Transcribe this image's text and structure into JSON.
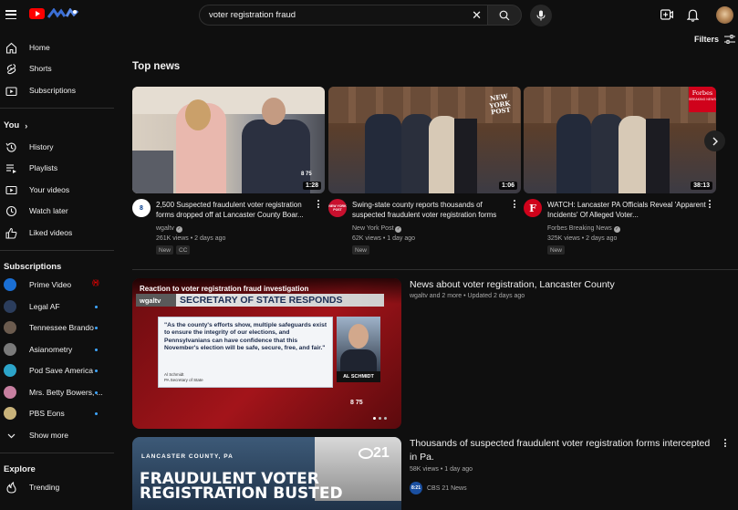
{
  "search": {
    "query": "voter registration fraud"
  },
  "header": {
    "filters_label": "Filters"
  },
  "sidebar": {
    "main": [
      {
        "label": "Home",
        "icon": "home-icon"
      },
      {
        "label": "Shorts",
        "icon": "shorts-icon"
      },
      {
        "label": "Subscriptions",
        "icon": "subscriptions-icon"
      }
    ],
    "you_label": "You",
    "you_items": [
      {
        "label": "History",
        "icon": "history-icon"
      },
      {
        "label": "Playlists",
        "icon": "playlists-icon"
      },
      {
        "label": "Your videos",
        "icon": "your-videos-icon"
      },
      {
        "label": "Watch later",
        "icon": "watch-later-icon"
      },
      {
        "label": "Liked videos",
        "icon": "liked-icon"
      }
    ],
    "subscriptions_label": "Subscriptions",
    "subscriptions": [
      {
        "label": "Prime Video",
        "status": "live",
        "color": "#1a6fd4"
      },
      {
        "label": "Legal AF",
        "status": "dot",
        "color": "#2b3d5c"
      },
      {
        "label": "Tennessee Brando",
        "status": "dot",
        "color": "#6b5b4e"
      },
      {
        "label": "Asianometry",
        "status": "dot",
        "color": "#7a7a7a"
      },
      {
        "label": "Pod Save America",
        "status": "dot",
        "color": "#2ca4c9"
      },
      {
        "label": "Mrs. Betty Bowers, ...",
        "status": "dot",
        "color": "#c77fa0"
      },
      {
        "label": "PBS Eons",
        "status": "dot",
        "color": "#c9b37a"
      }
    ],
    "show_more": "Show more",
    "explore_label": "Explore",
    "explore": [
      {
        "label": "Trending",
        "icon": "trending-icon"
      }
    ]
  },
  "top_news": {
    "heading": "Top news",
    "videos": [
      {
        "title": "2,500 Suspected fraudulent voter registration forms dropped off at Lancaster County Boar...",
        "channel": "wgaltv",
        "views": "261K views",
        "age": "2 days ago",
        "duration": "1:28",
        "badges": [
          "New",
          "CC"
        ],
        "channel_badge": "8"
      },
      {
        "title": "Swing-state county reports thousands of suspected fraudulent voter registration forms",
        "channel": "New York Post",
        "views": "62K views",
        "age": "1 day ago",
        "duration": "1:06",
        "badges": [
          "New"
        ],
        "channel_badge": "NEW YORK POST"
      },
      {
        "title": "WATCH: Lancaster PA Officials Reveal 'Apparent Incidents' Of Alleged Voter...",
        "channel": "Forbes Breaking News",
        "views": "325K views",
        "age": "2 days ago",
        "duration": "38:13",
        "badges": [
          "New"
        ],
        "channel_badge": "F"
      }
    ]
  },
  "section1": {
    "title": "News about voter registration, Lancaster County",
    "meta": "wgaltv and 2 more • Updated 2 days ago",
    "thumb": {
      "banner": "Reaction to voter registration fraud investigation",
      "station": "wgaltv",
      "headline": "SECRETARY OF STATE RESPONDS",
      "quote": "\"As the county's efforts show, multiple safeguards exist to ensure the integrity of our elections, and Pennsylvanians can have confidence that this November's election will be safe, secure, free, and fair.\"",
      "attribution_name": "Al Schmidt",
      "attribution_role": "PA Secretary of State",
      "name_tag": "AL SCHMIDT"
    }
  },
  "section2": {
    "title": "Thousands of suspected fraudulent voter registration forms intercepted in Pa.",
    "views": "58K views",
    "age": "1 day ago",
    "channel": "CBS 21 News",
    "thumb": {
      "location": "LANCASTER COUNTY, PA",
      "line1": "FRAUDULENT VOTER",
      "line2": "REGISTRATION BUSTED",
      "network": "21"
    }
  }
}
